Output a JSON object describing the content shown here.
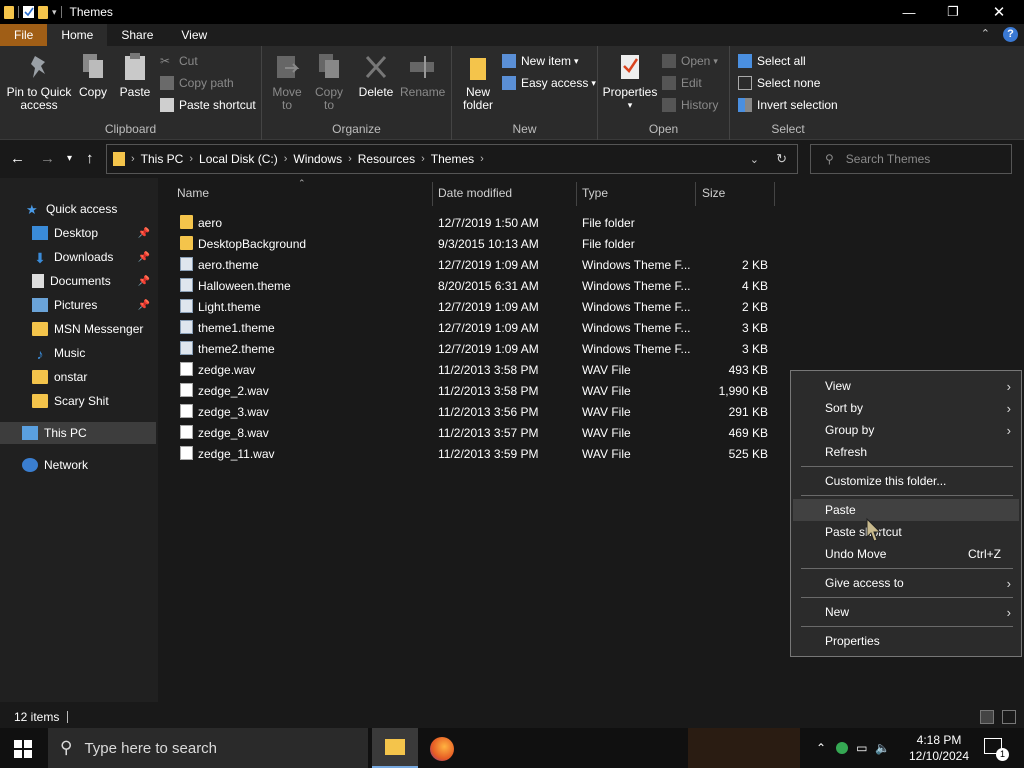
{
  "window": {
    "title": "Themes"
  },
  "tabs": [
    "File",
    "Home",
    "Share",
    "View"
  ],
  "ribbon": {
    "clipboard": {
      "pin": "Pin to Quick access",
      "copy": "Copy",
      "paste": "Paste",
      "cut": "Cut",
      "copy_path": "Copy path",
      "paste_shortcut": "Paste shortcut",
      "label": "Clipboard"
    },
    "organize": {
      "move_to": "Move to",
      "copy_to": "Copy to",
      "delete": "Delete",
      "rename": "Rename",
      "label": "Organize"
    },
    "new": {
      "new_folder": "New folder",
      "new_item": "New item",
      "easy_access": "Easy access",
      "label": "New"
    },
    "open": {
      "properties": "Properties",
      "open": "Open",
      "edit": "Edit",
      "history": "History",
      "label": "Open"
    },
    "select": {
      "select_all": "Select all",
      "select_none": "Select none",
      "invert": "Invert selection",
      "label": "Select"
    }
  },
  "address": {
    "crumbs": [
      "This PC",
      "Local Disk (C:)",
      "Windows",
      "Resources",
      "Themes"
    ]
  },
  "search": {
    "placeholder": "Search Themes"
  },
  "nav": {
    "quick_access": "Quick access",
    "items": [
      "Desktop",
      "Downloads",
      "Documents",
      "Pictures",
      "MSN Messenger",
      "Music",
      "onstar",
      "Scary Shit"
    ],
    "this_pc": "This PC",
    "network": "Network"
  },
  "columns": {
    "name": "Name",
    "date": "Date modified",
    "type": "Type",
    "size": "Size"
  },
  "files": [
    {
      "name": "aero",
      "date": "12/7/2019 1:50 AM",
      "type": "File folder",
      "size": "",
      "icon": "folder-icon"
    },
    {
      "name": "DesktopBackground",
      "date": "9/3/2015 10:13 AM",
      "type": "File folder",
      "size": "",
      "icon": "folder-icon"
    },
    {
      "name": "aero.theme",
      "date": "12/7/2019 1:09 AM",
      "type": "Windows Theme F...",
      "size": "2 KB",
      "icon": "theme-file-icon"
    },
    {
      "name": "Halloween.theme",
      "date": "8/20/2015 6:31 AM",
      "type": "Windows Theme F...",
      "size": "4 KB",
      "icon": "theme-file-icon"
    },
    {
      "name": "Light.theme",
      "date": "12/7/2019 1:09 AM",
      "type": "Windows Theme F...",
      "size": "2 KB",
      "icon": "theme-file-icon"
    },
    {
      "name": "theme1.theme",
      "date": "12/7/2019 1:09 AM",
      "type": "Windows Theme F...",
      "size": "3 KB",
      "icon": "theme-file-icon"
    },
    {
      "name": "theme2.theme",
      "date": "12/7/2019 1:09 AM",
      "type": "Windows Theme F...",
      "size": "3 KB",
      "icon": "theme-file-icon"
    },
    {
      "name": "zedge.wav",
      "date": "11/2/2013 3:58 PM",
      "type": "WAV File",
      "size": "493 KB",
      "icon": "wav-file-icon"
    },
    {
      "name": "zedge_2.wav",
      "date": "11/2/2013 3:58 PM",
      "type": "WAV File",
      "size": "1,990 KB",
      "icon": "wav-file-icon"
    },
    {
      "name": "zedge_3.wav",
      "date": "11/2/2013 3:56 PM",
      "type": "WAV File",
      "size": "291 KB",
      "icon": "wav-file-icon"
    },
    {
      "name": "zedge_8.wav",
      "date": "11/2/2013 3:57 PM",
      "type": "WAV File",
      "size": "469 KB",
      "icon": "wav-file-icon"
    },
    {
      "name": "zedge_11.wav",
      "date": "11/2/2013 3:59 PM",
      "type": "WAV File",
      "size": "525 KB",
      "icon": "wav-file-icon"
    }
  ],
  "context_menu": {
    "view": "View",
    "sort_by": "Sort by",
    "group_by": "Group by",
    "refresh": "Refresh",
    "customize": "Customize this folder...",
    "paste": "Paste",
    "paste_shortcut": "Paste shortcut",
    "undo_move": "Undo Move",
    "undo_shortcut": "Ctrl+Z",
    "give_access": "Give access to",
    "new": "New",
    "properties": "Properties"
  },
  "status": {
    "count": "12 items"
  },
  "taskbar": {
    "search_placeholder": "Type here to search",
    "time": "4:18 PM",
    "date": "12/10/2024",
    "notification_count": "1"
  },
  "colors": {
    "file_tab": "#a05e16",
    "folder": "#f4c44b",
    "accent": "#3a79d4"
  }
}
